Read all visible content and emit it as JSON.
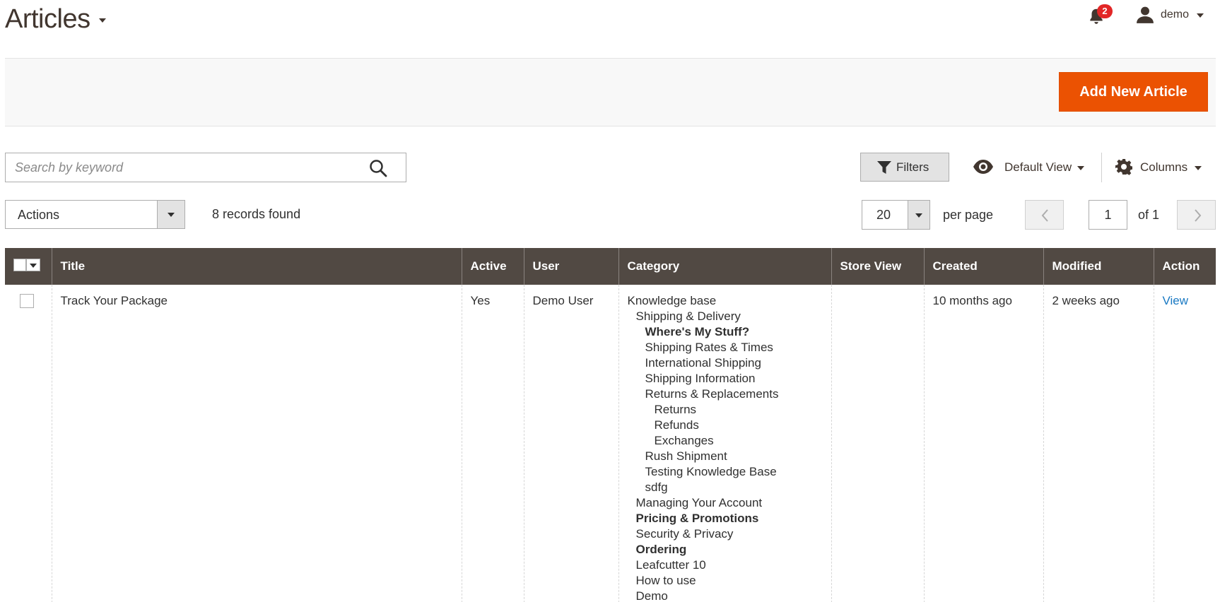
{
  "header": {
    "title": "Articles",
    "notification_count": "2",
    "user_name": "demo"
  },
  "toolbar": {
    "add_label": "Add New Article",
    "search_placeholder": "Search by keyword",
    "filters_label": "Filters",
    "view_label": "Default View",
    "columns_label": "Columns",
    "actions_label": "Actions",
    "records_found": "8 records found",
    "per_page_value": "20",
    "per_page_label": "per page",
    "current_page": "1",
    "page_of": "of 1"
  },
  "grid": {
    "columns": [
      "Title",
      "Active",
      "User",
      "Category",
      "Store View",
      "Created",
      "Modified",
      "Action"
    ],
    "rows": [
      {
        "title": "Track Your Package",
        "active": "Yes",
        "user": "Demo User",
        "store_view": "",
        "created": "10 months ago",
        "modified": "2 weeks ago",
        "action": "View",
        "categories": [
          {
            "label": "Knowledge base",
            "level": 0,
            "bold": false
          },
          {
            "label": "Shipping & Delivery",
            "level": 1,
            "bold": false
          },
          {
            "label": "Where's My Stuff?",
            "level": 2,
            "bold": true
          },
          {
            "label": "Shipping Rates & Times",
            "level": 2,
            "bold": false
          },
          {
            "label": "International Shipping",
            "level": 2,
            "bold": false
          },
          {
            "label": "Shipping Information",
            "level": 2,
            "bold": false
          },
          {
            "label": "Returns & Replacements",
            "level": 2,
            "bold": false
          },
          {
            "label": "Returns",
            "level": 3,
            "bold": false
          },
          {
            "label": "Refunds",
            "level": 3,
            "bold": false
          },
          {
            "label": "Exchanges",
            "level": 3,
            "bold": false
          },
          {
            "label": "Rush Shipment",
            "level": 2,
            "bold": false
          },
          {
            "label": "Testing Knowledge Base",
            "level": 2,
            "bold": false
          },
          {
            "label": "sdfg",
            "level": 2,
            "bold": false
          },
          {
            "label": "Managing Your Account",
            "level": 1,
            "bold": false
          },
          {
            "label": "Pricing & Promotions",
            "level": 1,
            "bold": true
          },
          {
            "label": "Security & Privacy",
            "level": 1,
            "bold": false
          },
          {
            "label": "Ordering",
            "level": 1,
            "bold": true
          },
          {
            "label": "Leafcutter 10",
            "level": 1,
            "bold": false
          },
          {
            "label": "How to use",
            "level": 1,
            "bold": false
          },
          {
            "label": "Demo",
            "level": 1,
            "bold": false
          }
        ]
      }
    ]
  },
  "colors": {
    "accent": "#eb5202",
    "header_bg": "#514943",
    "link": "#1979c3",
    "badge": "#e22626"
  }
}
